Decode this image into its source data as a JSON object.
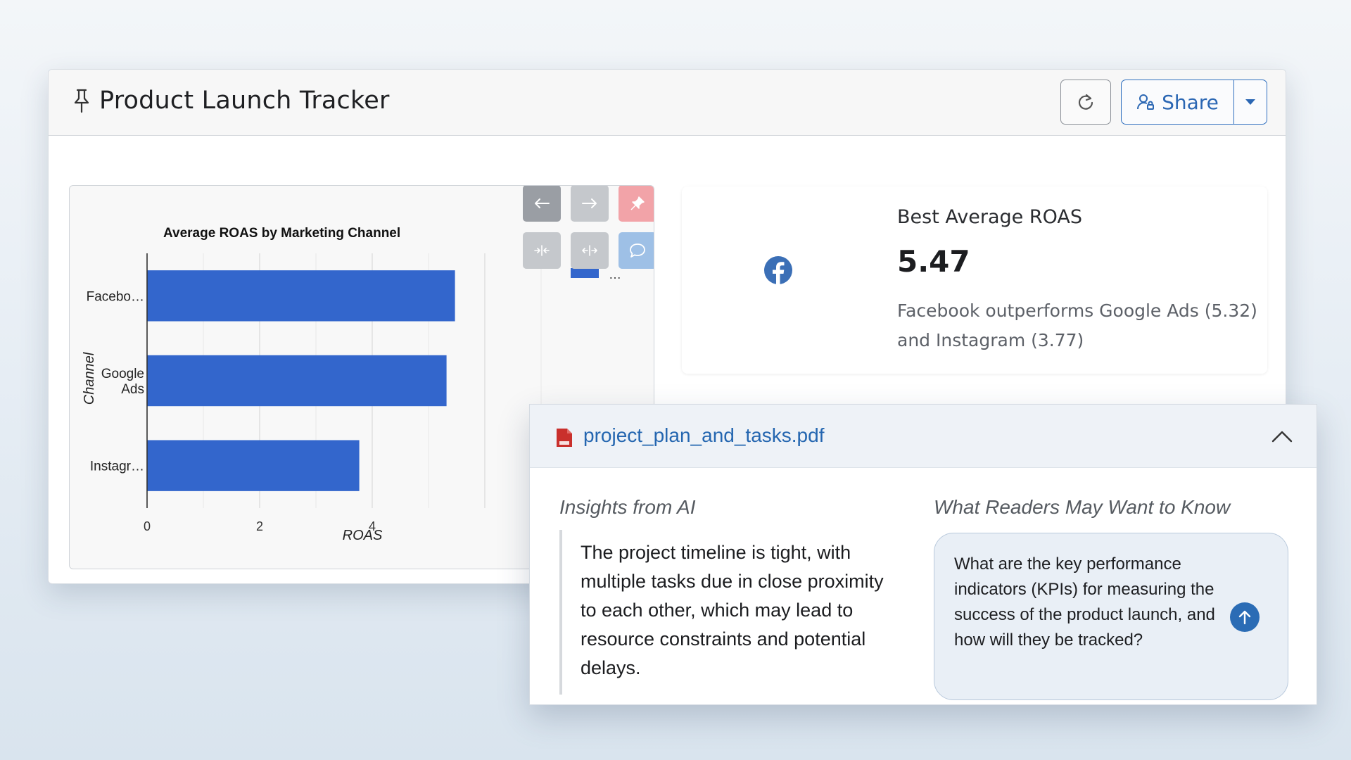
{
  "header": {
    "title": "Product Launch Tracker",
    "share_label": "Share"
  },
  "chart_data": {
    "type": "bar",
    "orientation": "horizontal",
    "title": "Average ROAS by Marketing Channel",
    "xlabel": "ROAS",
    "ylabel": "Channel",
    "categories": [
      "Facebo…",
      "Google Ads",
      "Instagr…"
    ],
    "category_tick_lines": [
      [
        "Facebo…"
      ],
      [
        "Google",
        "Ads"
      ],
      [
        "Instagr…"
      ]
    ],
    "values": [
      5.47,
      5.32,
      3.77
    ],
    "x_ticks": [
      "0",
      "2",
      "4"
    ],
    "xlim": [
      0,
      7
    ],
    "legend_text": "…",
    "bar_color": "#3366cc",
    "grid": true
  },
  "kpi": {
    "label": "Best Average ROAS",
    "value": "5.47",
    "description": "Facebook outperforms Google Ads (5.32) and Instagram (3.77)",
    "icon": "facebook-icon",
    "icon_color": "#3b6fb6"
  },
  "file_panel": {
    "file_name": "project_plan_and_tasks.pdf",
    "insights_title": "Insights from AI",
    "insight_text": "The project timeline is tight, with multiple tasks due in close proximity to each other, which may lead to resource constraints and potential delays.",
    "questions_title": "What Readers May Want to Know",
    "question_text": "What are the key performance indicators (KPIs) for measuring the success of the product launch, and how will they be tracked?"
  },
  "colors": {
    "accent": "#2a66b3",
    "bar": "#3366cc",
    "pin_button": "#f2a3a8",
    "nav_button_dark": "#9a9ea4",
    "comment_button": "#9ec0e6"
  }
}
